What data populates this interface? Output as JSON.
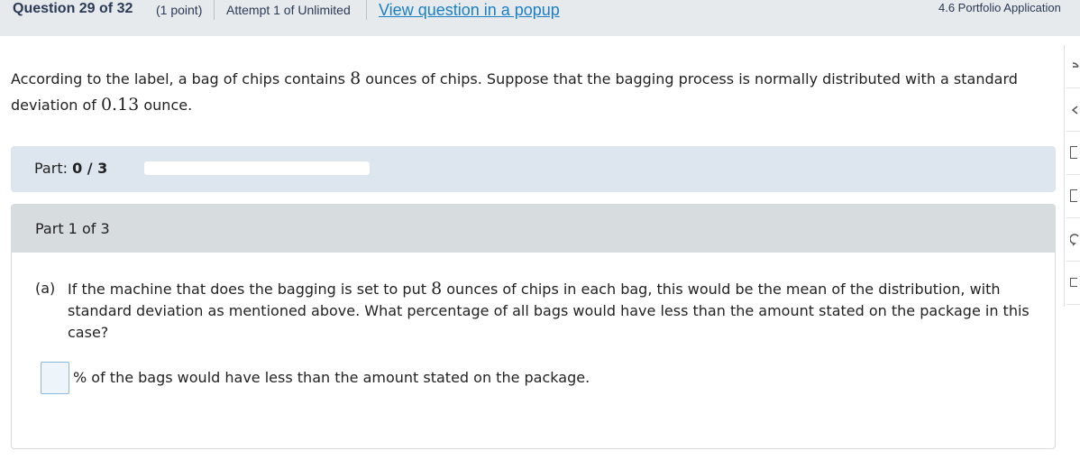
{
  "header": {
    "question_label": "Question 29 of 32",
    "points": "(1 point)",
    "attempt": "Attempt 1 of Unlimited",
    "popup_link": "View question in a popup",
    "section": "4.6 Portfolio Application"
  },
  "prompt": {
    "text_1": "According to the label, a bag of chips contains ",
    "num_1": "8",
    "text_2": " ounces of chips. Suppose that the bagging process is normally distributed with a standard deviation of ",
    "num_2": "0.13",
    "text_3": " ounce."
  },
  "progress": {
    "label": "Part: ",
    "value": "0 / 3",
    "fraction": 0
  },
  "part": {
    "title": "Part 1 of 3",
    "letter": "(a)",
    "q_text_1": "If the machine that does the bagging is set to put ",
    "q_num": "8",
    "q_text_2": " ounces of chips in each bag, this would be the mean of the distribution, with standard deviation as mentioned above. What percentage of all bags would have less than the amount stated on the package in this case?",
    "answer_value": "",
    "answer_suffix": "% of the bags would have less than the amount stated on the package."
  },
  "toolbar": {
    "icons": [
      "calculator-icon",
      "back-icon",
      "bracket-icon",
      "bracket-icon-2",
      "chat-icon",
      "box-icon"
    ]
  }
}
